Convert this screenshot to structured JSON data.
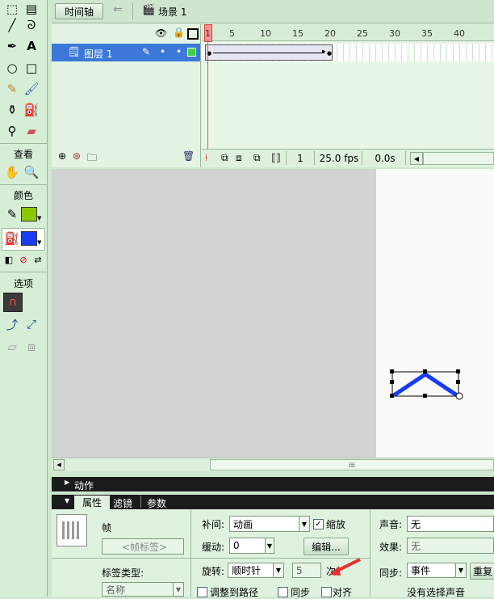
{
  "toolbox": {
    "view_label": "查看",
    "color_label": "颜色",
    "options_label": "选项"
  },
  "timeline": {
    "timeline_button": "时间轴",
    "scene_label": "场景 1",
    "ruler": [
      "1",
      "5",
      "10",
      "15",
      "20",
      "25",
      "30",
      "35",
      "40"
    ],
    "layer_name": "图层 1",
    "current_frame": "1",
    "fps": "25.0 fps",
    "elapsed": "0.0s"
  },
  "panels": {
    "actions_title": "动作",
    "tabs": [
      "属性",
      "滤镜",
      "参数"
    ]
  },
  "properties": {
    "frame_label": "帧",
    "frame_name_placeholder": "<帧标签>",
    "label_type_label": "标签类型:",
    "label_type_value": "名称",
    "tween_label": "补间:",
    "tween_value": "动画",
    "scale_label": "缩放",
    "ease_label": "缓动:",
    "ease_value": "0",
    "edit_button": "编辑...",
    "rotate_label": "旋转:",
    "rotate_value": "顺时针",
    "rotate_count": "5",
    "times_label": "次",
    "orient_label": "调整到路径",
    "sync_label": "同步",
    "snap_label": "对齐",
    "sound_label": "声音:",
    "sound_value": "无",
    "effect_label": "效果:",
    "effect_value": "无",
    "sync2_label": "同步:",
    "sync2_value": "事件",
    "repeat_button": "重复",
    "no_sound_label": "没有选择声音"
  },
  "colors": {
    "stroke_swatch": "#8cc800",
    "fill_swatch": "#1a3cf0",
    "shape": "#1a3cf0",
    "playhead": "#e05050"
  }
}
